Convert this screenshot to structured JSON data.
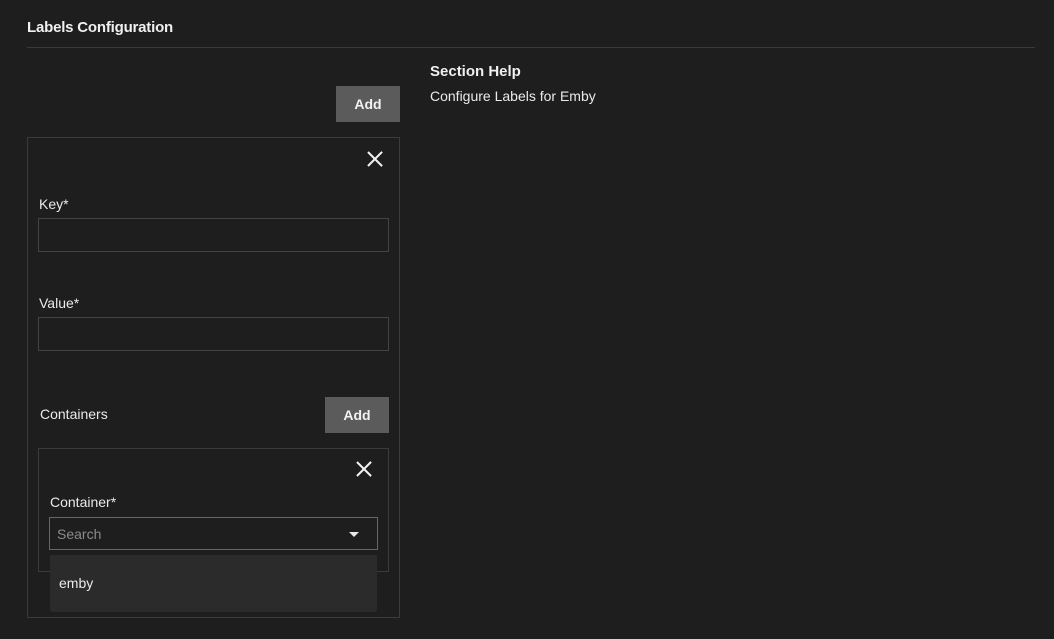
{
  "section": {
    "title": "Labels Configuration",
    "add_label": "Add"
  },
  "label_item": {
    "key": {
      "label": "Key",
      "required_mark": "*",
      "value": ""
    },
    "value": {
      "label": "Value",
      "required_mark": "*",
      "value": ""
    },
    "containers": {
      "label": "Containers",
      "add_label": "Add",
      "item": {
        "container": {
          "label": "Container",
          "required_mark": "*",
          "placeholder": "Search",
          "value": "",
          "options": [
            "emby"
          ]
        }
      }
    }
  },
  "help": {
    "title": "Section Help",
    "text": "Configure Labels for Emby"
  },
  "colors": {
    "background": "#1e1e1e",
    "button": "#5b5b5b",
    "focus_border": "#0e7fd0"
  }
}
